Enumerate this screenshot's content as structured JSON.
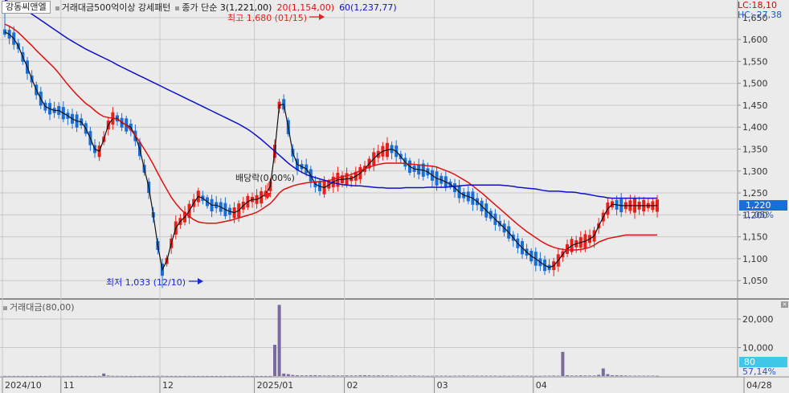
{
  "legend": {
    "stock_name": "강동씨앤엘",
    "indicator": "거래대금500억이상 강세패턴",
    "ma_title": "종가 단순",
    "ma3": "3(1,221,00)",
    "ma20": "20(1,154,00)",
    "ma60": "60(1,237,77)"
  },
  "right_info": {
    "lc": "LC:18,10",
    "hc": "HC:-27,38"
  },
  "volume_legend": "거래대금(80,00)",
  "annotations": {
    "high": "최고 1,680 (01/15)",
    "low": "최저 1,033 (12/10)",
    "dividend": "배당락(0,00%)"
  },
  "current": {
    "price": "1,220",
    "change": "-1,05%",
    "vol_value": "80",
    "vol_change": "57,14%"
  },
  "colors": {
    "up": "#e8201c",
    "down": "#1a6ed8",
    "ma3": "#111111",
    "ma20": "#e01010",
    "ma60": "#1010c8",
    "volume": "#7a6aa0",
    "grid": "#c8c8c8",
    "bg": "#ebebeb"
  },
  "chart_data": [
    {
      "type": "candlestick",
      "title": "",
      "y_ticks": [
        "1,650",
        "1,600",
        "1,550",
        "1,500",
        "1,450",
        "1,400",
        "1,350",
        "1,300",
        "1,250",
        "1,200",
        "1,150",
        "1,100",
        "1,050"
      ],
      "ylim": [
        1010,
        1690
      ],
      "x_tick_labels": [
        "2024/10",
        "11",
        "12",
        "2025/01",
        "02",
        "03",
        "04",
        "04/28"
      ],
      "x_tick_index": [
        0,
        13,
        35,
        56,
        76,
        96,
        118,
        155
      ],
      "series": [
        {
          "name": "3",
          "values": [
            1617,
            1612,
            1602,
            1585,
            1560,
            1537,
            1510,
            1485,
            1465,
            1447,
            1442,
            1438,
            1438,
            1432,
            1426,
            1419,
            1414,
            1412,
            1397,
            1375,
            1350,
            1345,
            1372,
            1405,
            1420,
            1420,
            1410,
            1405,
            1400,
            1380,
            1350,
            1305,
            1263,
            1200,
            1130,
            1075,
            1095,
            1135,
            1170,
            1185,
            1195,
            1209,
            1227,
            1242,
            1238,
            1230,
            1222,
            1222,
            1218,
            1212,
            1208,
            1205,
            1210,
            1221,
            1230,
            1235,
            1235,
            1240,
            1248,
            1265,
            1345,
            1450,
            1452,
            1400,
            1342,
            1315,
            1310,
            1305,
            1290,
            1270,
            1265,
            1262,
            1268,
            1275,
            1280,
            1281,
            1282,
            1283,
            1288,
            1295,
            1305,
            1317,
            1328,
            1338,
            1345,
            1348,
            1350,
            1345,
            1333,
            1320,
            1310,
            1305,
            1303,
            1302,
            1298,
            1290,
            1283,
            1280,
            1275,
            1270,
            1262,
            1252,
            1245,
            1242,
            1238,
            1230,
            1220,
            1210,
            1200,
            1190,
            1180,
            1170,
            1160,
            1148,
            1135,
            1125,
            1115,
            1106,
            1100,
            1092,
            1085,
            1080,
            1084,
            1096,
            1110,
            1122,
            1130,
            1134,
            1137,
            1140,
            1145,
            1152,
            1175,
            1195,
            1214,
            1224,
            1223,
            1221,
            1221,
            1221,
            1221,
            1221,
            1221,
            1221,
            1221,
            1221
          ]
        },
        {
          "name": "20",
          "values": [
            1635,
            1630,
            1624,
            1616,
            1606,
            1596,
            1586,
            1575,
            1565,
            1555,
            1545,
            1535,
            1523,
            1510,
            1497,
            1485,
            1474,
            1464,
            1454,
            1447,
            1438,
            1430,
            1424,
            1422,
            1420,
            1418,
            1412,
            1404,
            1394,
            1381,
            1366,
            1350,
            1333,
            1315,
            1295,
            1276,
            1258,
            1240,
            1226,
            1214,
            1204,
            1196,
            1189,
            1184,
            1182,
            1181,
            1181,
            1181,
            1183,
            1185,
            1187,
            1190,
            1193,
            1196,
            1199,
            1202,
            1206,
            1212,
            1219,
            1226,
            1237,
            1250,
            1258,
            1262,
            1266,
            1269,
            1271,
            1273,
            1274,
            1275,
            1276,
            1277,
            1278,
            1281,
            1284,
            1287,
            1289,
            1292,
            1296,
            1301,
            1305,
            1309,
            1312,
            1315,
            1317,
            1318,
            1318,
            1318,
            1318,
            1317,
            1316,
            1315,
            1314,
            1313,
            1312,
            1311,
            1309,
            1305,
            1301,
            1297,
            1292,
            1286,
            1280,
            1274,
            1266,
            1258,
            1250,
            1241,
            1232,
            1223,
            1214,
            1205,
            1196,
            1187,
            1178,
            1170,
            1162,
            1155,
            1148,
            1141,
            1135,
            1130,
            1126,
            1123,
            1121,
            1120,
            1120,
            1120,
            1121,
            1123,
            1126,
            1131,
            1138,
            1142,
            1146,
            1148,
            1150,
            1152,
            1154,
            1154,
            1154,
            1154,
            1154,
            1154,
            1154,
            1154
          ]
        },
        {
          "name": "60",
          "values": [
            1690,
            1686,
            1682,
            1677,
            1672,
            1665,
            1658,
            1651,
            1644,
            1637,
            1630,
            1623,
            1616,
            1609,
            1602,
            1596,
            1590,
            1584,
            1578,
            1573,
            1568,
            1563,
            1558,
            1553,
            1548,
            1542,
            1537,
            1532,
            1527,
            1522,
            1517,
            1512,
            1507,
            1502,
            1497,
            1492,
            1487,
            1482,
            1477,
            1472,
            1467,
            1462,
            1457,
            1452,
            1447,
            1442,
            1437,
            1432,
            1427,
            1422,
            1417,
            1412,
            1407,
            1401,
            1395,
            1388,
            1380,
            1372,
            1363,
            1354,
            1345,
            1336,
            1327,
            1318,
            1310,
            1303,
            1297,
            1292,
            1288,
            1285,
            1282,
            1279,
            1276,
            1273,
            1271,
            1269,
            1268,
            1267,
            1266,
            1266,
            1265,
            1264,
            1263,
            1262,
            1262,
            1261,
            1261,
            1261,
            1261,
            1262,
            1262,
            1262,
            1262,
            1262,
            1263,
            1263,
            1263,
            1263,
            1263,
            1264,
            1265,
            1266,
            1267,
            1268,
            1268,
            1268,
            1268,
            1268,
            1268,
            1268,
            1268,
            1267,
            1266,
            1265,
            1263,
            1262,
            1261,
            1260,
            1259,
            1257,
            1255,
            1254,
            1254,
            1254,
            1253,
            1252,
            1252,
            1251,
            1249,
            1248,
            1246,
            1244,
            1242,
            1241,
            1239,
            1238,
            1238,
            1238,
            1238,
            1238,
            1238,
            1238,
            1238,
            1238,
            1238,
            1238
          ]
        }
      ]
    },
    {
      "type": "bar",
      "title": "",
      "series_name": "거래대금",
      "y_ticks": [
        "20,000",
        "10,000"
      ],
      "ylim": [
        0,
        26500
      ],
      "values": [
        50,
        40,
        60,
        50,
        40,
        30,
        50,
        40,
        40,
        30,
        80,
        90,
        50,
        60,
        40,
        50,
        60,
        50,
        60,
        40,
        30,
        60,
        900,
        200,
        100,
        60,
        80,
        50,
        40,
        40,
        30,
        60,
        50,
        50,
        80,
        100,
        60,
        50,
        60,
        40,
        30,
        60,
        50,
        40,
        40,
        30,
        30,
        40,
        40,
        50,
        40,
        40,
        40,
        50,
        50,
        40,
        50,
        30,
        40,
        50,
        11000,
        25000,
        900,
        700,
        400,
        300,
        250,
        250,
        300,
        300,
        250,
        200,
        200,
        250,
        200,
        200,
        250,
        200,
        200,
        300,
        300,
        250,
        200,
        250,
        200,
        200,
        200,
        150,
        150,
        150,
        200,
        200,
        150,
        150,
        100,
        100,
        150,
        150,
        150,
        100,
        150,
        150,
        200,
        150,
        150,
        150,
        150,
        150,
        150,
        150,
        100,
        150,
        100,
        150,
        150,
        150,
        150,
        100,
        100,
        100,
        150,
        150,
        200,
        150,
        8500,
        300,
        200,
        200,
        250,
        200,
        200,
        200,
        450,
        2700,
        700,
        300,
        300,
        250,
        200,
        150,
        150,
        150,
        150,
        150,
        150,
        100
      ]
    }
  ]
}
